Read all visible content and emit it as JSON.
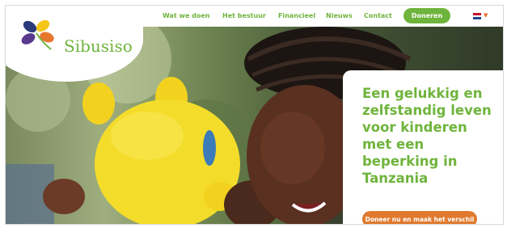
{
  "nav": {
    "items": [
      {
        "label": "Wat we doen"
      },
      {
        "label": "Het bestuur"
      },
      {
        "label": "Financieel"
      },
      {
        "label": "Nieuws"
      },
      {
        "label": "Contact"
      }
    ],
    "donate_label": "Doneren",
    "language_icon": "netherlands-flag-icon"
  },
  "logo": {
    "text": "Sibusiso",
    "mark_icon": "flower-petals-icon"
  },
  "hero": {
    "title": "Een gelukkig en zelfstandig leven voor kinderen met een beperking in Tanzania",
    "cta_label": "Doneer nu en maak het verschil",
    "image_description_icon": "hero-photo"
  },
  "colors": {
    "brand_green": "#6fb43c",
    "cta_orange": "#e07a2e",
    "petal_yellow": "#f5c518",
    "petal_orange": "#e8772e",
    "petal_navy": "#2b3a7a",
    "petal_purple": "#5a3a8c"
  }
}
